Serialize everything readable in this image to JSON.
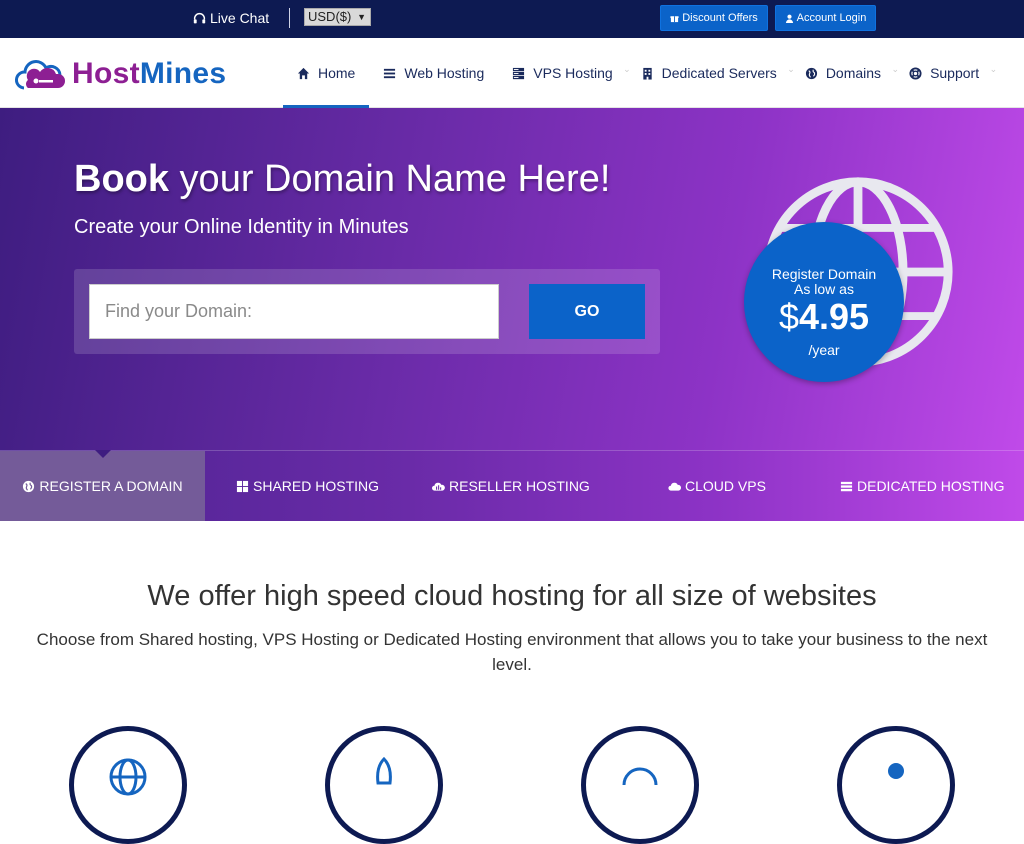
{
  "topbar": {
    "live_chat": "Live Chat",
    "currency": "USD($)",
    "discount_offers": "Discount Offers",
    "account_login": "Account Login"
  },
  "logo": {
    "host": "Host",
    "mines": "Mines"
  },
  "nav": {
    "items": [
      {
        "label": "Home",
        "icon": "home-icon"
      },
      {
        "label": "Web Hosting",
        "icon": "list-icon"
      },
      {
        "label": "VPS Hosting",
        "icon": "server-icon"
      },
      {
        "label": "Dedicated Servers",
        "icon": "building-icon"
      },
      {
        "label": "Domains",
        "icon": "globe-icon"
      },
      {
        "label": "Support",
        "icon": "lifebuoy-icon"
      }
    ]
  },
  "hero": {
    "title_bold": "Book",
    "title_rest": " your Domain Name Here!",
    "subtitle": "Create your Online Identity in Minutes",
    "search_placeholder": "Find your Domain:",
    "go_label": "GO",
    "badge_line1": "Register Domain",
    "badge_line2": "As low as",
    "badge_currency": "$",
    "badge_price": "4.95",
    "badge_period": "/year"
  },
  "tabs": [
    {
      "label": "REGISTER A DOMAIN",
      "icon": "globe-icon"
    },
    {
      "label": "SHARED HOSTING",
      "icon": "grid-icon"
    },
    {
      "label": "RESELLER HOSTING",
      "icon": "cloud-chart-icon"
    },
    {
      "label": "CLOUD VPS",
      "icon": "cloud-icon"
    },
    {
      "label": "DEDICATED HOSTING",
      "icon": "server-icon"
    }
  ],
  "offer": {
    "title": "We offer high speed cloud hosting for all size of websites",
    "text": "Choose from Shared hosting, VPS Hosting or Dedicated Hosting environment that allows you to take your business to the next level."
  },
  "colors": {
    "topbar": "#0d1a52",
    "accent": "#0b63c9",
    "logo_host": "#8d1f93",
    "logo_mines": "#1565c0"
  }
}
